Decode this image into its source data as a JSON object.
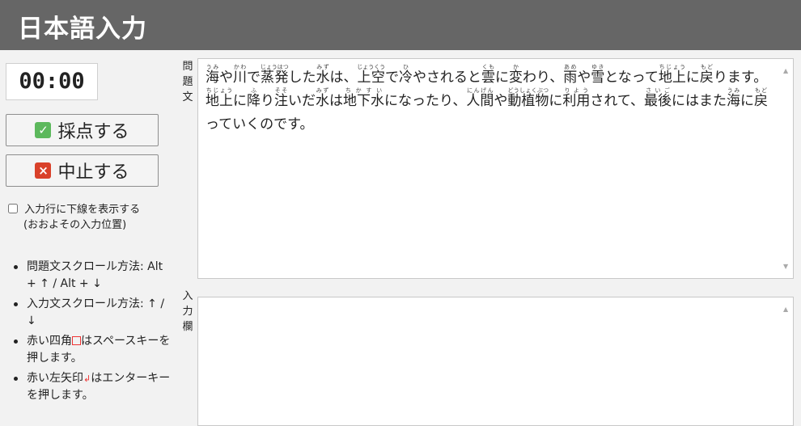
{
  "header": {
    "title": "日本語入力"
  },
  "timer": {
    "value": "00:00"
  },
  "buttons": {
    "score_icon": "✓",
    "score_label": "採点する",
    "stop_icon": "×",
    "stop_label": "中止する"
  },
  "checkbox": {
    "label": "入力行に下線を表示する",
    "sub": "(おおよその入力位置)",
    "checked": false
  },
  "tips": {
    "t1": "問題文スクロール方法: Alt + ↑ / Alt + ↓",
    "t2": "入力文スクロール方法: ↑ / ↓",
    "t3_pre": "赤い四角",
    "t3_post": "はスペースキーを押します。",
    "t4_pre": "赤い左矢印",
    "t4_arrow": "↲",
    "t4_post": "はエンターキーを押します。"
  },
  "labels": {
    "question": [
      "問",
      "題",
      "文"
    ],
    "input": [
      "入",
      "力",
      "欄"
    ]
  },
  "question": {
    "segments": [
      {
        "b": "海",
        "r": "うみ"
      },
      {
        "t": "や"
      },
      {
        "b": "川",
        "r": "かわ"
      },
      {
        "t": "で"
      },
      {
        "b": "蒸発",
        "r": "じょうはつ"
      },
      {
        "t": "した"
      },
      {
        "b": "水",
        "r": "みず"
      },
      {
        "t": "は、"
      },
      {
        "b": "上空",
        "r": "じょうくう"
      },
      {
        "t": "で"
      },
      {
        "b": "冷",
        "r": "ひ"
      },
      {
        "t": "やされると"
      },
      {
        "b": "雲",
        "r": "くも"
      },
      {
        "t": "に"
      },
      {
        "b": "変",
        "r": "か"
      },
      {
        "t": "わり、"
      },
      {
        "b": "雨",
        "r": "あめ"
      },
      {
        "t": "や"
      },
      {
        "b": "雪",
        "r": "ゆき"
      },
      {
        "t": "となって"
      },
      {
        "b": "地上",
        "r": "ちじょう"
      },
      {
        "t": "に"
      },
      {
        "b": "戻",
        "r": "もど"
      },
      {
        "t": "ります。"
      },
      {
        "b": "地上",
        "r": "ちじょう"
      },
      {
        "t": "に"
      },
      {
        "b": "降",
        "r": "ふ"
      },
      {
        "t": "り"
      },
      {
        "b": "注",
        "r": "そそ"
      },
      {
        "t": "いだ"
      },
      {
        "b": "水",
        "r": "みず"
      },
      {
        "t": "は"
      },
      {
        "b": "地下水",
        "r": "ちかすい"
      },
      {
        "t": "になったり、"
      },
      {
        "b": "人間",
        "r": "にんげん"
      },
      {
        "t": "や"
      },
      {
        "b": "動植物",
        "r": "どうしょくぶつ"
      },
      {
        "t": "に"
      },
      {
        "b": "利用",
        "r": "りよう"
      },
      {
        "t": "されて、"
      },
      {
        "b": "最後",
        "r": "さいご"
      },
      {
        "t": "にはまた"
      },
      {
        "b": "海",
        "r": "うみ"
      },
      {
        "t": "に"
      },
      {
        "b": "戻",
        "r": "もど"
      },
      {
        "t": "っていくのです。"
      }
    ]
  },
  "input": {
    "value": ""
  },
  "scrollbar": {
    "up": "▲",
    "down": "▼"
  }
}
